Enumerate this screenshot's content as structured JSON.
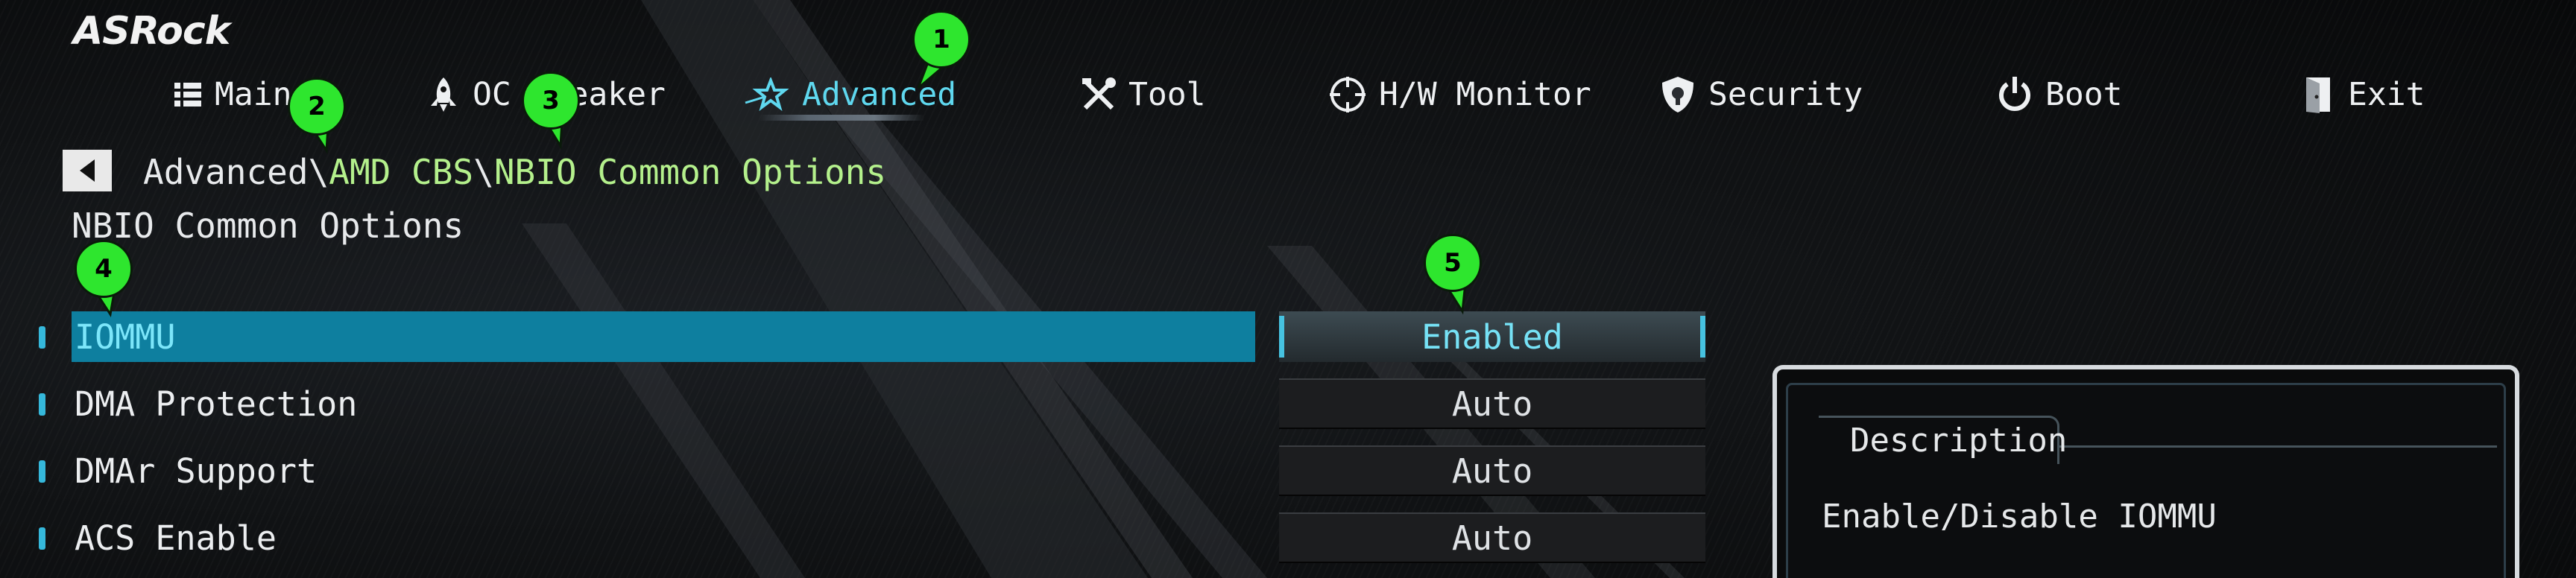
{
  "brand": {
    "logo": "ASRock"
  },
  "nav": {
    "tabs": [
      {
        "label": "Main",
        "icon": "list-icon"
      },
      {
        "label": "OC Tweaker",
        "icon": "rocket-icon"
      },
      {
        "label": "Advanced",
        "icon": "star-icon",
        "active": true
      },
      {
        "label": "Tool",
        "icon": "tools-icon"
      },
      {
        "label": "H/W Monitor",
        "icon": "crosshair-icon"
      },
      {
        "label": "Security",
        "icon": "shield-icon"
      },
      {
        "label": "Boot",
        "icon": "power-icon"
      },
      {
        "label": "Exit",
        "icon": "exit-door-icon"
      }
    ]
  },
  "breadcrumb": {
    "root": "Advanced",
    "separator": "\\",
    "part1": "AMD CBS",
    "part2": "NBIO Common Options"
  },
  "page": {
    "title": "NBIO Common Options"
  },
  "options": [
    {
      "label": "IOMMU",
      "value": "Enabled",
      "selected": true
    },
    {
      "label": "DMA Protection",
      "value": "Auto"
    },
    {
      "label": "DMAr Support",
      "value": "Auto"
    },
    {
      "label": "ACS Enable",
      "value": "Auto"
    }
  ],
  "description": {
    "title": "Description",
    "text": "Enable/Disable IOMMU"
  },
  "annotations": {
    "m1": "1",
    "m2": "2",
    "m3": "3",
    "m4": "4",
    "m5": "5"
  },
  "colors": {
    "accent": "#5fd8ef",
    "selection": "#0e7f9f",
    "breadcrumb_link": "#b4f08c",
    "annotation": "#2ee62e"
  }
}
